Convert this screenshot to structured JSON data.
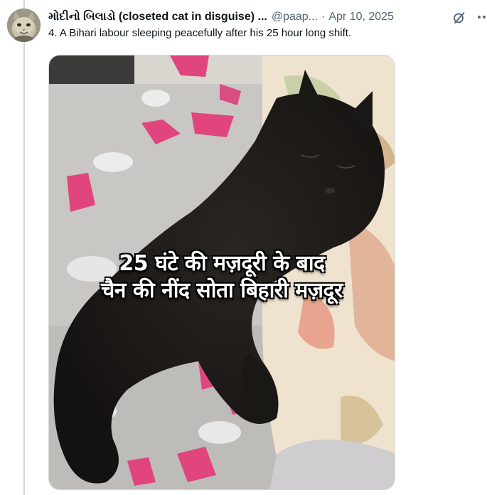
{
  "post": {
    "display_name": "મોદીનો બિલાડો (closeted cat in disguise) ...",
    "handle": "@paap...",
    "separator": "·",
    "date": "Apr 10, 2025",
    "text": "4. A Bihari labour sleeping peacefully after his 25 hour long shift."
  },
  "media": {
    "caption_line1": "25 घंटे की मज़दूरी के बाद",
    "caption_line2": "चैन की नींद सोता बिहारी मज़दूर"
  },
  "icons": {
    "grok": "grok-icon",
    "more": "more-icon",
    "avatar": "avatar"
  },
  "colors": {
    "secondary_text": "#536471",
    "primary_text": "#0f1419",
    "thread_line": "#cfd9de"
  }
}
